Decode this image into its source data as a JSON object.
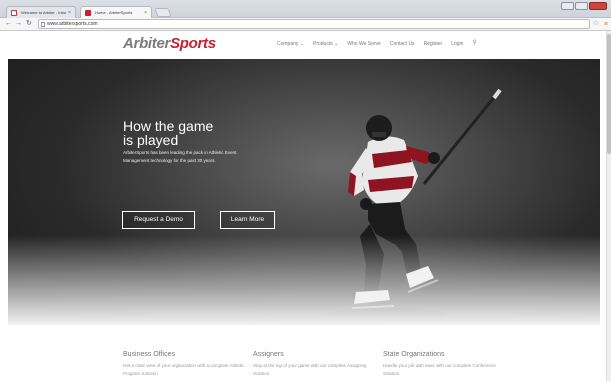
{
  "browser": {
    "tabs": [
      {
        "title": "Welcome to Arbiter - Inbo"
      },
      {
        "title": "Home - ArbiterSports"
      }
    ],
    "url": "www.arbitersports.com"
  },
  "header": {
    "logo_part1": "Arbiter",
    "logo_part2": "Sports",
    "nav": [
      "Company ⌄",
      "Products ⌄",
      "Who We Serve",
      "Contact Us",
      "Register",
      "Login"
    ]
  },
  "hero": {
    "title_line1": "How the game",
    "title_line2": "is played",
    "text": "ArbiterSports has been leading the pack in Athletic Event Management technology for the past 30 years.",
    "btn_demo": "Request a Demo",
    "btn_more": "Learn More"
  },
  "features": [
    {
      "title": "Business Offices",
      "desc": "Get a clear view of your organization with a complete Athletic Program Solution"
    },
    {
      "title": "Assigners",
      "desc": "Stay at the top of your game with our complete Assigning Solution"
    },
    {
      "title": "State Organizations",
      "desc": "Handle your job with ease with our complete Conference Solution"
    }
  ],
  "colors": {
    "brand_red": "#c8202f",
    "brand_gray": "#7b7b7b"
  }
}
